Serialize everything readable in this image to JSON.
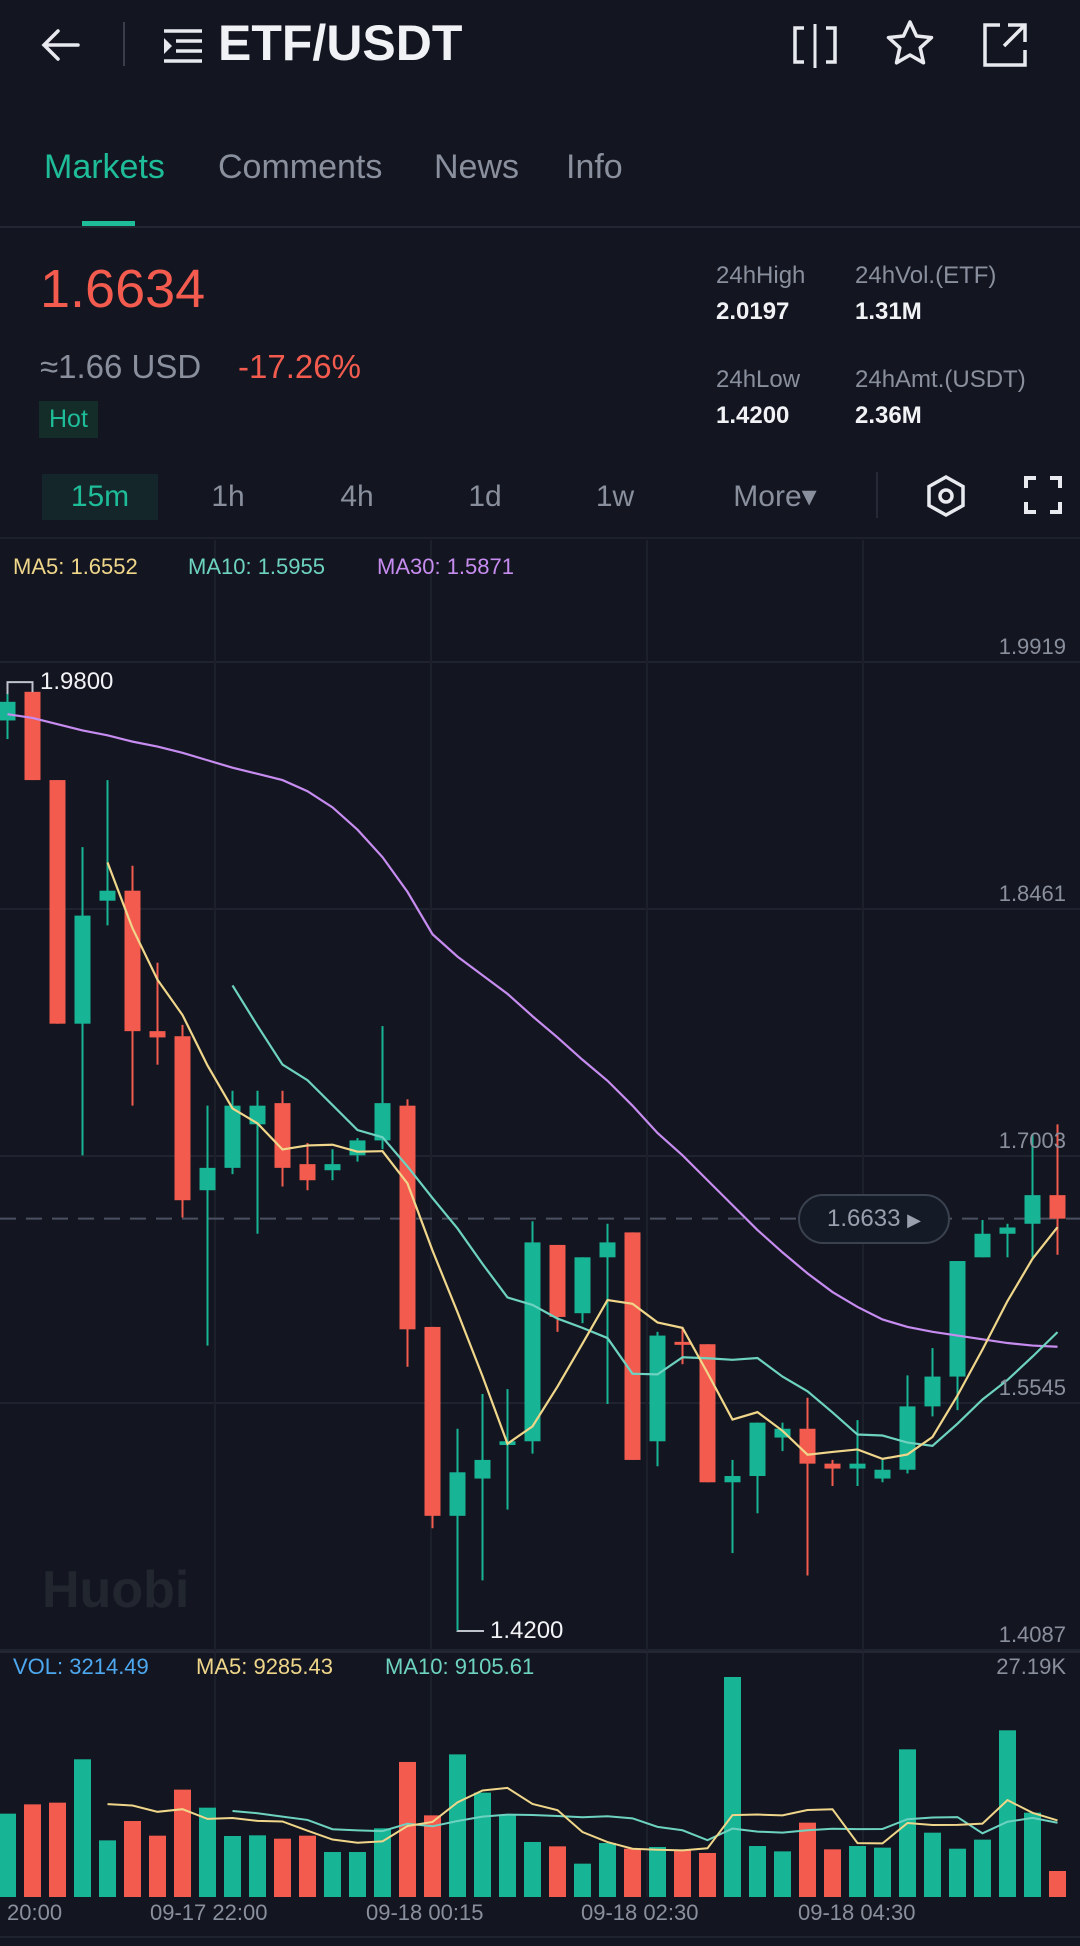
{
  "header": {
    "title": "ETF/USDT",
    "icons": [
      "back-arrow-icon",
      "pair-list-icon",
      "compare-icon",
      "star-icon",
      "share-icon"
    ]
  },
  "tabs": [
    {
      "label": "Markets",
      "active": true
    },
    {
      "label": "Comments"
    },
    {
      "label": "News"
    },
    {
      "label": "Info"
    }
  ],
  "ticker": {
    "price": "1.6634",
    "usd": "≈1.66 USD",
    "change": "-17.26%",
    "badge": "Hot",
    "stats": [
      {
        "label": "24hHigh",
        "value": "2.0197"
      },
      {
        "label": "24hVol.(ETF)",
        "value": "1.31M"
      },
      {
        "label": "24hLow",
        "value": "1.4200"
      },
      {
        "label": "24hAmt.(USDT)",
        "value": "2.36M"
      }
    ]
  },
  "timeframes": [
    {
      "label": "15m",
      "active": true
    },
    {
      "label": "1h"
    },
    {
      "label": "4h"
    },
    {
      "label": "1d"
    },
    {
      "label": "1w"
    },
    {
      "label": "More▾"
    }
  ],
  "legend": {
    "ma5": "MA5: 1.6552",
    "ma10": "MA10: 1.5955",
    "ma30": "MA30: 1.5871"
  },
  "vol_legend": {
    "vol": "VOL: 3214.49",
    "ma5": "MA5: 9285.43",
    "ma10": "MA10: 9105.61",
    "max": "27.19K"
  },
  "colors": {
    "up": "#17b495",
    "down": "#f35b4f",
    "ma5": "#f0d68a",
    "ma10": "#6dd3c0",
    "ma30": "#c78cf0",
    "vol": "#4da8f0",
    "bg": "#131620"
  },
  "watermark": "Huobi",
  "chart_data": {
    "type": "candlestick",
    "interval": "15m",
    "y_ticks": [
      "1.9919",
      "1.8461",
      "1.7003",
      "1.5545",
      "1.4087"
    ],
    "ylim": [
      1.4087,
      1.9919
    ],
    "x_ticks": [
      "20:00",
      "09-17 22:00",
      "09-18 00:15",
      "09-18 02:30",
      "09-18 04:30"
    ],
    "high_marker": "1.9800",
    "low_marker": "1.4200",
    "current_price": "1.6633",
    "ohlc": [
      [
        1.9574,
        1.9794,
        1.9464,
        1.9684
      ],
      [
        1.9743,
        1.98,
        1.9222,
        1.9222
      ],
      [
        1.9222,
        1.9222,
        1.7784,
        1.7784
      ],
      [
        1.7784,
        1.8826,
        1.7007,
        1.8422
      ],
      [
        1.851,
        1.9222,
        1.8364,
        1.8569
      ],
      [
        1.8569,
        1.8716,
        1.73,
        1.774
      ],
      [
        1.774,
        1.8144,
        1.7542,
        1.7703
      ],
      [
        1.771,
        1.7777,
        1.664,
        1.6742
      ],
      [
        1.6801,
        1.73,
        1.5884,
        1.6933
      ],
      [
        1.6933,
        1.7388,
        1.6896,
        1.73
      ],
      [
        1.719,
        1.7388,
        1.6544,
        1.73
      ],
      [
        1.7315,
        1.7388,
        1.6823,
        1.6933
      ],
      [
        1.6955,
        1.708,
        1.6801,
        1.686
      ],
      [
        1.6919,
        1.7043,
        1.686,
        1.6955
      ],
      [
        1.7007,
        1.7109,
        1.697,
        1.7095
      ],
      [
        1.7095,
        1.777,
        1.7043,
        1.7315
      ],
      [
        1.73,
        1.7337,
        1.5759,
        1.598
      ],
      [
        1.5994,
        1.5994,
        1.4806,
        1.4879
      ],
      [
        1.4879,
        1.5393,
        1.42,
        1.5136
      ],
      [
        1.5099,
        1.5598,
        1.4498,
        1.5209
      ],
      [
        1.5297,
        1.5627,
        1.4916,
        1.5319
      ],
      [
        1.5319,
        1.6618,
        1.5246,
        1.6493
      ],
      [
        1.6478,
        1.6478,
        1.5965,
        1.6053
      ],
      [
        1.6075,
        1.6405,
        1.6016,
        1.6405
      ],
      [
        1.6405,
        1.6603,
        1.5539,
        1.6493
      ],
      [
        1.6552,
        1.6552,
        1.5209,
        1.5209
      ],
      [
        1.5319,
        1.5965,
        1.5172,
        1.5943
      ],
      [
        1.5906,
        1.5994,
        1.5774,
        1.5892
      ],
      [
        1.5892,
        1.5892,
        1.5077,
        1.5077
      ],
      [
        1.5077,
        1.5209,
        1.4659,
        1.5114
      ],
      [
        1.5114,
        1.5429,
        1.4894,
        1.5429
      ],
      [
        1.5341,
        1.5429,
        1.5261,
        1.5393
      ],
      [
        1.5393,
        1.5576,
        1.4527,
        1.5187
      ],
      [
        1.5187,
        1.5209,
        1.5055,
        1.5158
      ],
      [
        1.5158,
        1.5444,
        1.5055,
        1.5187
      ],
      [
        1.5099,
        1.5209,
        1.5077,
        1.5151
      ],
      [
        1.5151,
        1.5708,
        1.5129,
        1.5525
      ],
      [
        1.5525,
        1.5869,
        1.5466,
        1.5701
      ],
      [
        1.5701,
        1.6383,
        1.5503,
        1.6383
      ],
      [
        1.6405,
        1.6625,
        1.6405,
        1.6544
      ],
      [
        1.6544,
        1.6603,
        1.6405,
        1.6581
      ],
      [
        1.6603,
        1.7131,
        1.6405,
        1.6772
      ],
      [
        1.6772,
        1.719,
        1.642,
        1.6633
      ]
    ],
    "ma30": [
      1.9611,
      1.9589,
      1.9552,
      1.9515,
      1.9486,
      1.9449,
      1.942,
      1.9383,
      1.9339,
      1.9295,
      1.9259,
      1.9222,
      1.9156,
      1.9061,
      1.8929,
      1.8767,
      1.8562,
      1.8312,
      1.818,
      1.807,
      1.796,
      1.7828,
      1.7703,
      1.7571,
      1.7447,
      1.73,
      1.7139,
      1.7007,
      1.686,
      1.6713,
      1.6566,
      1.6434,
      1.631,
      1.62,
      1.6112,
      1.6038,
      1.5994,
      1.5965,
      1.5943,
      1.5921,
      1.5899,
      1.5884,
      1.5877
    ],
    "volume": [
      10300,
      11450,
      11660,
      17020,
      7000,
      9390,
      7580,
      13270,
      11040,
      7540,
      7620,
      7210,
      7580,
      5560,
      5560,
      8490,
      16690,
      10090,
      17630,
      12900,
      10090,
      6800,
      6260,
      4120,
      6670,
      5970,
      6180,
      5850,
      5440,
      27190,
      6300,
      5640,
      9190,
      5890,
      6300,
      6100,
      18250,
      7950,
      5970,
      7090,
      20600,
      10420,
      3214.49
    ],
    "volume_max": 27190
  }
}
